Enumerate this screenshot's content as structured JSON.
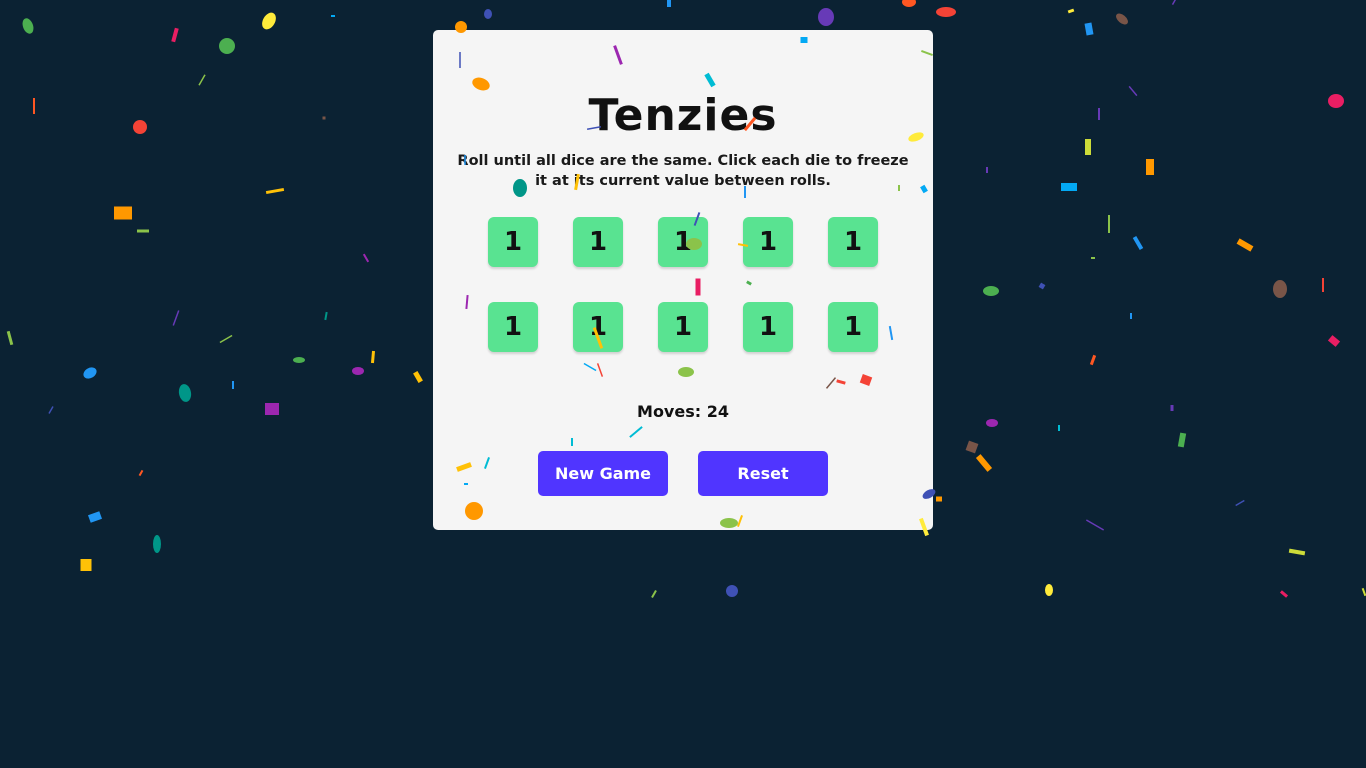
{
  "game": {
    "title": "Tenzies",
    "instructions": "Roll until all dice are the same. Click each die to freeze it at its current value between rolls.",
    "dice": [
      "1",
      "1",
      "1",
      "1",
      "1",
      "1",
      "1",
      "1",
      "1",
      "1"
    ],
    "moves_label": "Moves: 24",
    "new_game_label": "New Game",
    "reset_label": "Reset"
  },
  "colors": {
    "background": "#0b2233",
    "board": "#f5f5f5",
    "die_held": "#59e391",
    "button": "#5035ff",
    "confetti": [
      "#f44336",
      "#e91e63",
      "#9c27b0",
      "#673ab7",
      "#3f51b5",
      "#2196f3",
      "#03a9f4",
      "#00bcd4",
      "#009688",
      "#4caf50",
      "#8bc34a",
      "#cddc39",
      "#ffeb3b",
      "#ffc107",
      "#ff9800",
      "#ff5722",
      "#795548"
    ]
  }
}
